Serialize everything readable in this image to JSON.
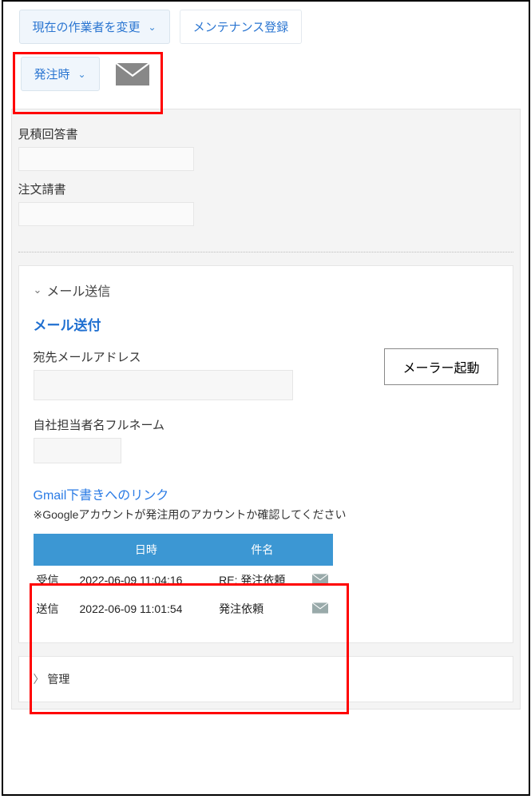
{
  "toolbar": {
    "change_worker_label": "現在の作業者を変更",
    "maintenance_label": "メンテナンス登録",
    "order_time_label": "発注時"
  },
  "fields": {
    "quote_reply_label": "見積回答書",
    "order_form_label": "注文請書"
  },
  "mail_panel": {
    "panel_title": "メール送信",
    "send_title": "メール送付",
    "to_label": "宛先メールアドレス",
    "launch_mailer_label": "メーラー起動",
    "self_name_label": "自社担当者名フルネーム",
    "gmail_link": "Gmail下書きへのリンク",
    "note": "※Googleアカウントが発注用のアカウントか確認してください"
  },
  "table": {
    "headers": {
      "datetime": "日時",
      "subject": "件名"
    },
    "rows": [
      {
        "direction": "受信",
        "datetime": "2022-06-09 11:04:16",
        "subject": "RE: 発注依頼"
      },
      {
        "direction": "送信",
        "datetime": "2022-06-09 11:01:54",
        "subject": "発注依頼"
      }
    ]
  },
  "manage": {
    "title": "管理"
  }
}
